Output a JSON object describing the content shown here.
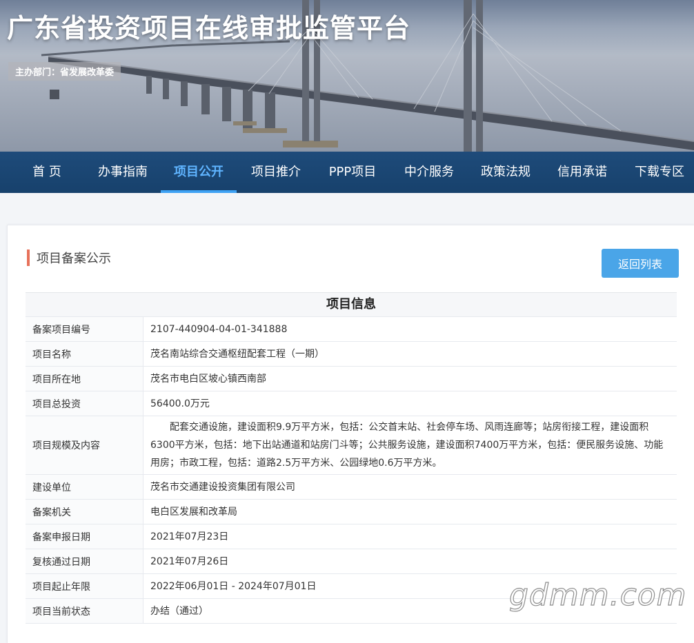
{
  "header": {
    "site_title": "广东省投资项目在线审批监管平台",
    "sponsor": "主办部门：省发展改革委"
  },
  "nav": {
    "items": [
      {
        "label": "首  页"
      },
      {
        "label": "办事指南"
      },
      {
        "label": "项目公开"
      },
      {
        "label": "项目推介"
      },
      {
        "label": "PPP项目"
      },
      {
        "label": "中介服务"
      },
      {
        "label": "政策法规"
      },
      {
        "label": "信用承诺"
      },
      {
        "label": "下载专区"
      }
    ],
    "active_index": 2
  },
  "section": {
    "title": "项目备案公示",
    "back_button": "返回列表"
  },
  "table": {
    "caption": "项目信息",
    "rows": [
      {
        "label": "备案项目编号",
        "value": "2107-440904-04-01-341888"
      },
      {
        "label": "项目名称",
        "value": "茂名南站综合交通枢纽配套工程（一期）"
      },
      {
        "label": "项目所在地",
        "value": "茂名市电白区坡心镇西南部"
      },
      {
        "label": "项目总投资",
        "value": "56400.0万元"
      },
      {
        "label": "项目规模及内容",
        "value": "配套交通设施，建设面积9.9万平方米，包括：公交首末站、社会停车场、风雨连廊等；站房衔接工程，建设面积6300平方米，包括：地下出站通道和站房门斗等；公共服务设施，建设面积7400万平方米，包括：便民服务设施、功能用房；市政工程，包括：道路2.5万平方米、公园绿地0.6万平方米。"
      },
      {
        "label": "建设单位",
        "value": "茂名市交通建设投资集团有限公司"
      },
      {
        "label": "备案机关",
        "value": "电白区发展和改革局"
      },
      {
        "label": "备案申报日期",
        "value": "2021年07月23日"
      },
      {
        "label": "复核通过日期",
        "value": "2021年07月26日"
      },
      {
        "label": "项目起止年限",
        "value": "2022年06月01日 - 2024年07月01日"
      },
      {
        "label": "项目当前状态",
        "value": "办结（通过）"
      }
    ]
  },
  "watermark": "gdmm.com",
  "colors": {
    "nav_bg": "#1e4b7a",
    "nav_active": "#5fb4ff",
    "accent_bar": "#e7715a",
    "button_bg": "#4aa5e8"
  }
}
